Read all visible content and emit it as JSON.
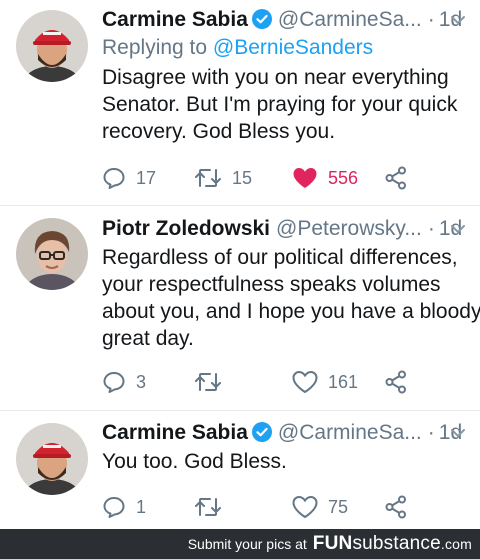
{
  "colors": {
    "accent": "#1da1f2",
    "liked": "#e0245e",
    "muted": "#657786",
    "footer_bg": "#2b2e33"
  },
  "tweets": [
    {
      "author": "Carmine Sabia",
      "verified": true,
      "handle": "@CarmineSa...",
      "separator": "·",
      "time": "1d",
      "replying_prefix": "Replying to",
      "replying_to": "@BernieSanders",
      "text_lines": [
        "Disagree with you on near everything",
        "Senator. But I'm praying for your quick",
        "recovery. God Bless you."
      ],
      "replies": "17",
      "retweets": "15",
      "likes": "556",
      "liked": true,
      "avatar_icon": "person-red-cap-avatar"
    },
    {
      "author": "Piotr Zoledowski",
      "verified": false,
      "handle": "@Peterowsky...",
      "separator": "·",
      "time": "1d",
      "text_lines": [
        "Regardless of our political differences,",
        "your respectfulness speaks volumes",
        "about you, and I hope you have a bloody",
        "great day."
      ],
      "replies": "3",
      "retweets": "",
      "likes": "161",
      "liked": false,
      "avatar_icon": "person-glasses-avatar"
    },
    {
      "author": "Carmine Sabia",
      "verified": true,
      "handle": "@CarmineSa...",
      "separator": "·",
      "time": "1d",
      "text_lines": [
        "You too. God Bless."
      ],
      "replies": "1",
      "retweets": "",
      "likes": "75",
      "liked": false,
      "avatar_icon": "person-red-cap-avatar"
    }
  ],
  "footer": {
    "text": "Submit your pics at",
    "brand_bold": "FUN",
    "brand_rest": "substance",
    "brand_suffix": ".com"
  }
}
